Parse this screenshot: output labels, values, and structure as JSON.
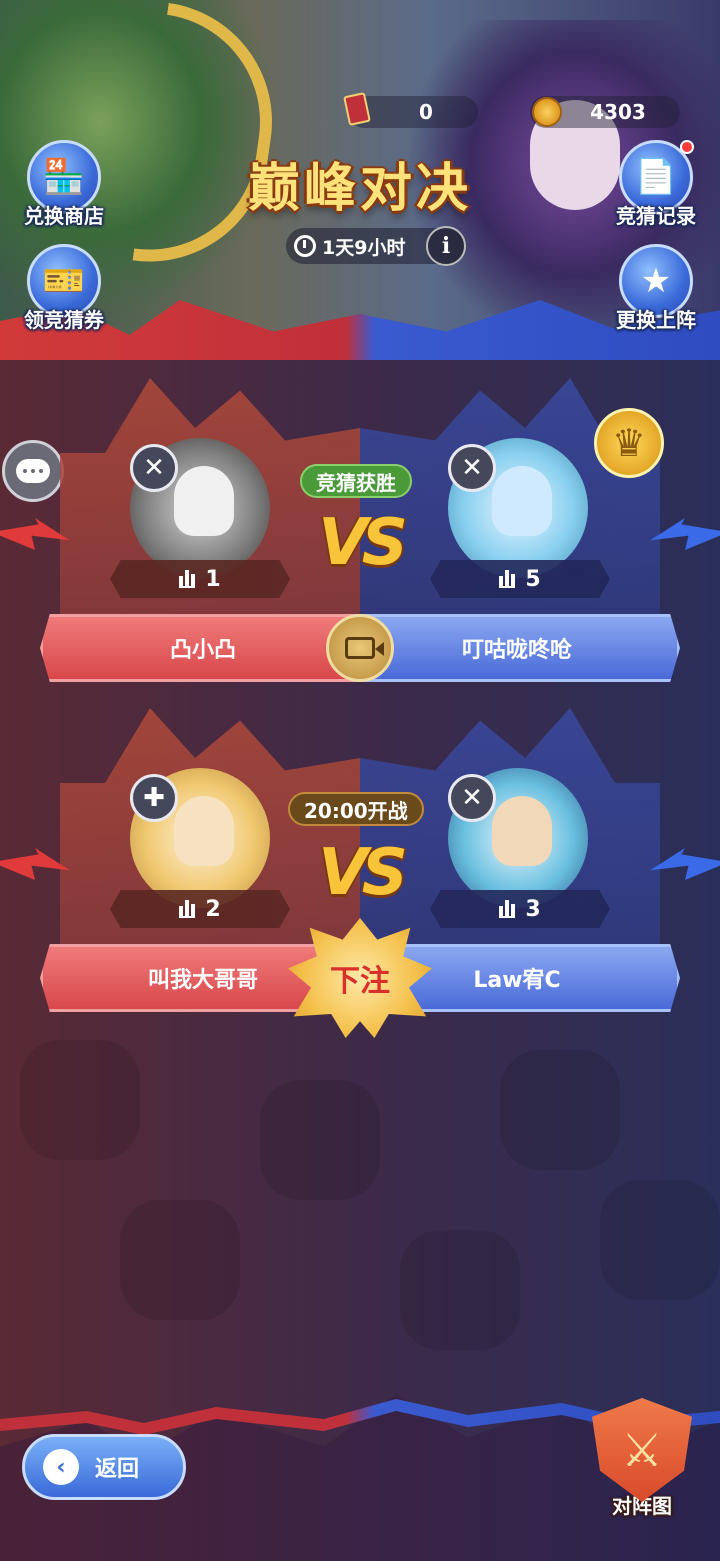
{
  "header": {
    "title": "巅峰对决",
    "ticket_count": "0",
    "coin_count": "4303",
    "timer": "1天9小时",
    "info_label": "i"
  },
  "side_buttons": {
    "exchange_shop": "兑换商店",
    "get_coupon": "领竞猜券",
    "guess_record": "竞猜记录",
    "change_lineup": "更换上阵"
  },
  "matches": [
    {
      "status": "竞猜获胜",
      "vs": "VS",
      "left": {
        "rank": "1",
        "name": "凸小凸"
      },
      "right": {
        "rank": "5",
        "name": "叮咕咙咚呛"
      }
    },
    {
      "status": "20:00开战",
      "vs": "VS",
      "left": {
        "rank": "2",
        "name": "叫我大哥哥"
      },
      "right": {
        "rank": "3",
        "name": "Law宥C"
      },
      "bet_label": "下注"
    }
  ],
  "footer": {
    "back_label": "返回",
    "bracket_label": "对阵图"
  },
  "colors": {
    "red_side": "#d8484a",
    "blue_side": "#4a6ad8",
    "gold": "#f7c43a",
    "win_green": "#4a9a3a"
  }
}
